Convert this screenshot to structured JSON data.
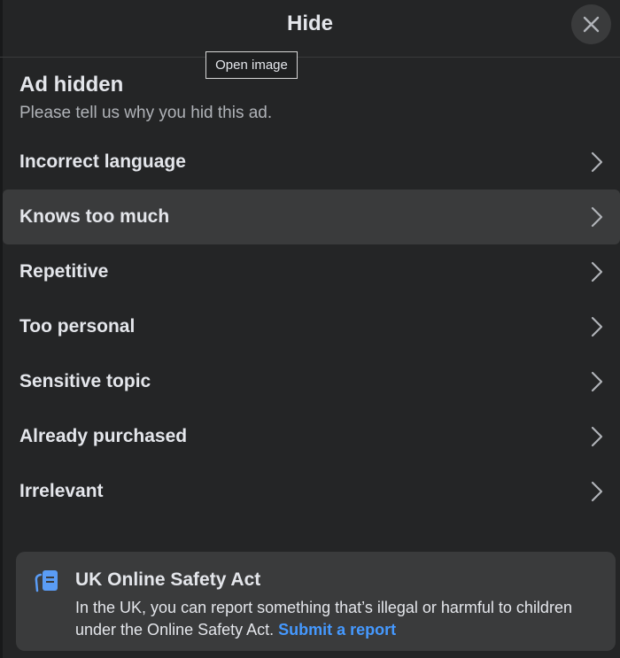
{
  "header": {
    "title": "Hide",
    "close_icon": "close-icon"
  },
  "tooltip": {
    "text": "Open image"
  },
  "section": {
    "title": "Ad hidden",
    "subtitle": "Please tell us why you hid this ad."
  },
  "options": [
    {
      "label": "Incorrect language",
      "icon": "chevron-right-icon"
    },
    {
      "label": "Knows too much",
      "icon": "chevron-right-icon",
      "highlighted": true
    },
    {
      "label": "Repetitive",
      "icon": "chevron-right-icon"
    },
    {
      "label": "Too personal",
      "icon": "chevron-right-icon"
    },
    {
      "label": "Sensitive topic",
      "icon": "chevron-right-icon"
    },
    {
      "label": "Already purchased",
      "icon": "chevron-right-icon"
    },
    {
      "label": "Irrelevant",
      "icon": "chevron-right-icon"
    }
  ],
  "info": {
    "icon": "report-icon",
    "title": "UK Online Safety Act",
    "body": "In the UK, you can report something that’s illegal or harmful to children under the Online Safety Act.",
    "link_text": "Submit a report"
  },
  "colors": {
    "background": "#242526",
    "hover_row": "#3a3b3c",
    "info_box": "#3a3b3c",
    "link": "#4599ff",
    "report_icon": "#5a9cf5"
  }
}
